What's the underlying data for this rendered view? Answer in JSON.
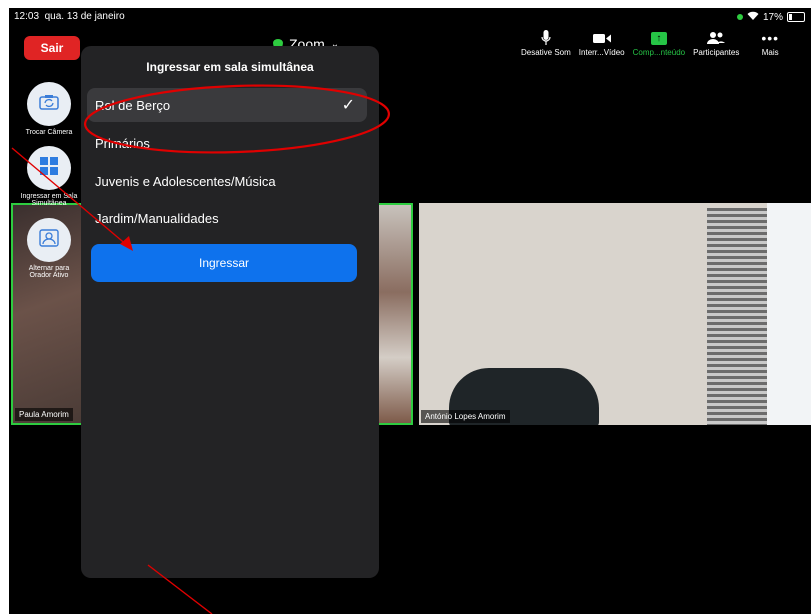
{
  "status_bar": {
    "time": "12:03",
    "date": "qua. 13 de janeiro",
    "battery": "17%"
  },
  "top_bar": {
    "leave_label": "Sair",
    "title": "Zoom",
    "toolbar": [
      {
        "id": "mute",
        "label": "Desative Som",
        "icon": "microphone-icon"
      },
      {
        "id": "video",
        "label": "Interr...Vídeo",
        "icon": "video-camera-icon"
      },
      {
        "id": "share",
        "label": "Comp...nteúdo",
        "icon": "share-screen-icon"
      },
      {
        "id": "participants",
        "label": "Participantes",
        "icon": "participants-icon"
      },
      {
        "id": "more",
        "label": "Mais",
        "icon": "more-dots-icon"
      }
    ]
  },
  "side_buttons": [
    {
      "label": "Trocar Câmera",
      "icon": "switch-camera-icon"
    },
    {
      "label": "Ingressar em Sala Simultânea",
      "icon": "breakout-rooms-icon"
    },
    {
      "label": "Alternar para Orador Ativo",
      "icon": "active-speaker-icon"
    }
  ],
  "participants": {
    "left": "Paula Amorim",
    "right": "António Lopes Amorim"
  },
  "modal": {
    "title": "Ingressar em sala simultânea",
    "rooms": [
      {
        "name": "Rol de Berço",
        "selected": true
      },
      {
        "name": "Primários",
        "selected": false
      },
      {
        "name": "Juvenis e Adolescentes/Música",
        "selected": false
      },
      {
        "name": "Jardim/Manualidades",
        "selected": false
      }
    ],
    "join_label": "Ingressar",
    "check_glyph": "✓"
  },
  "colors": {
    "leave_red": "#e02424",
    "join_blue": "#0e72ed",
    "active_green": "#2ecc40",
    "annotation_red": "#e00000"
  }
}
